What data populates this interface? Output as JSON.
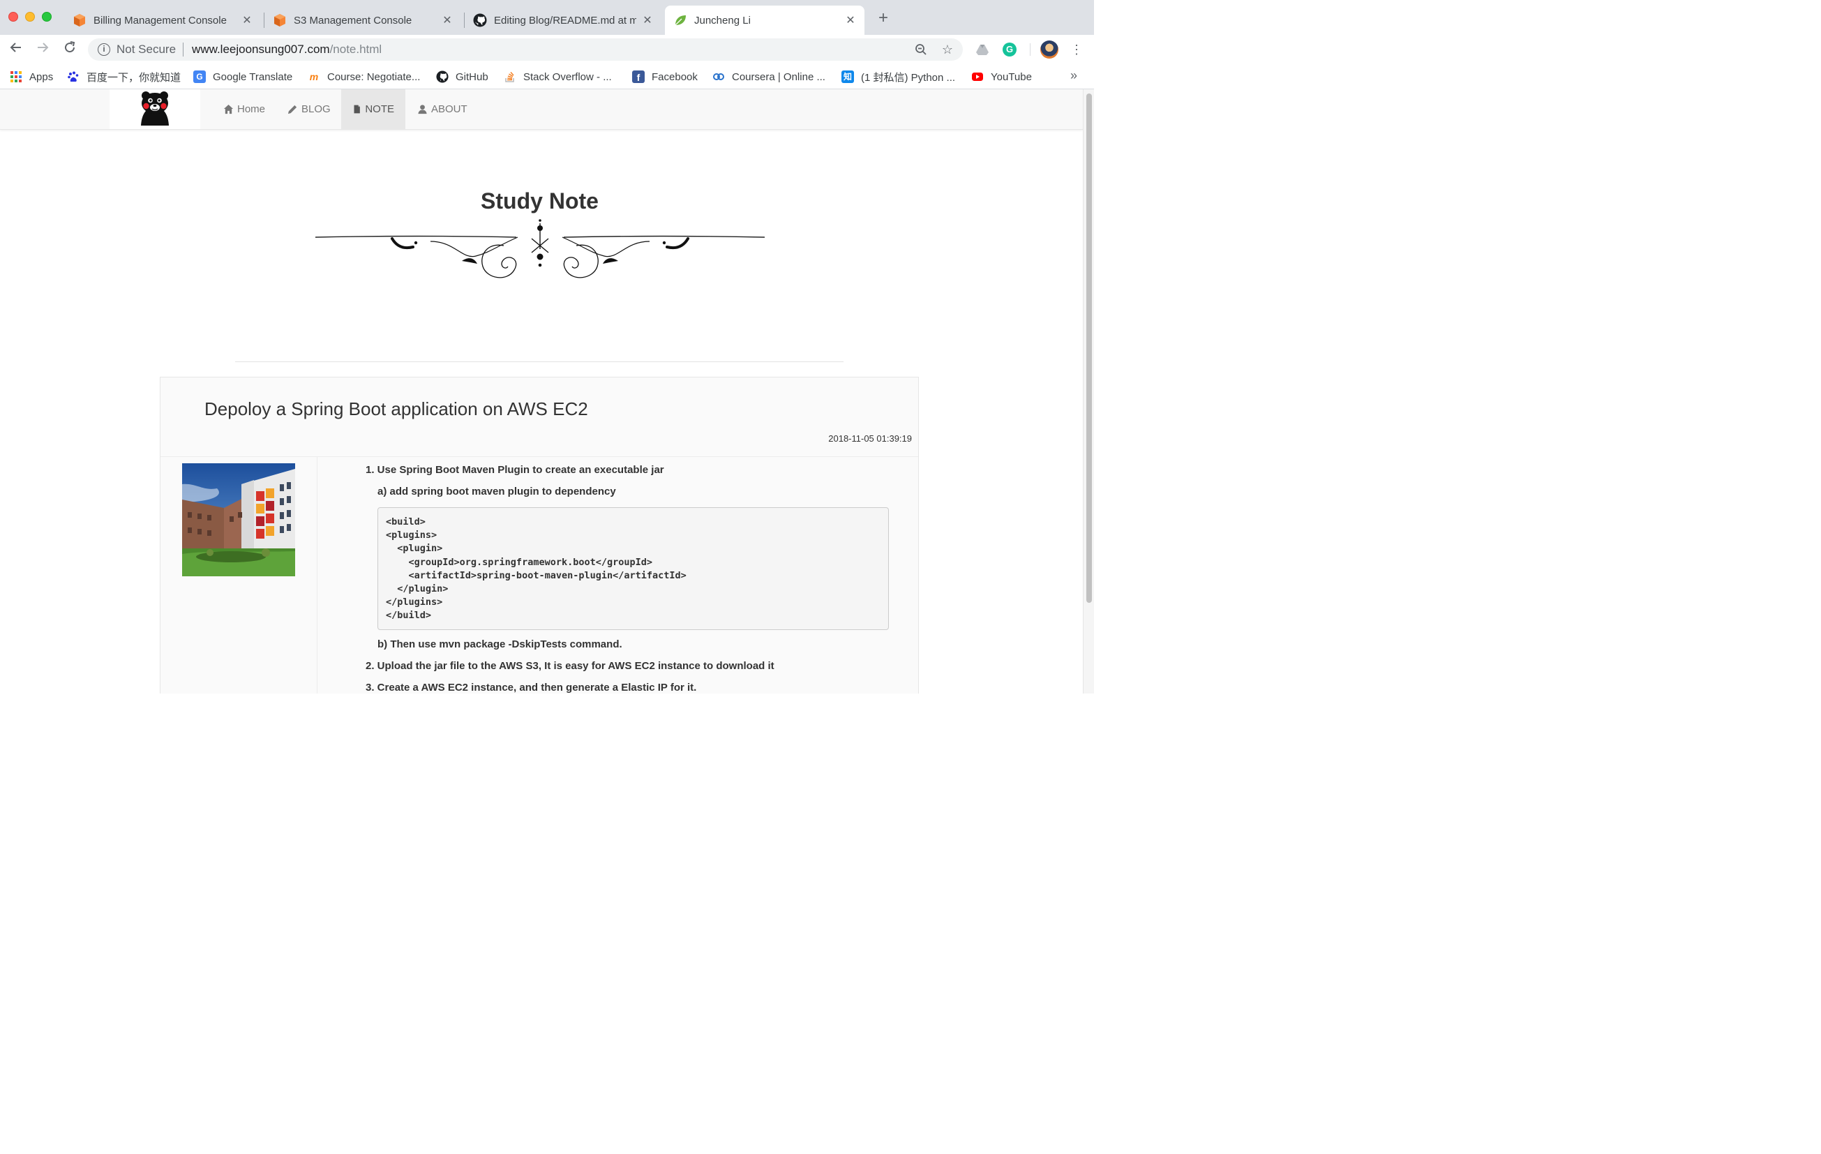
{
  "browser": {
    "tabs": [
      {
        "title": "Billing Management Console",
        "icon": "aws-cube-icon"
      },
      {
        "title": "S3 Management Console",
        "icon": "aws-cube-icon"
      },
      {
        "title": "Editing Blog/README.md at master",
        "icon": "github-icon"
      },
      {
        "title": "Juncheng Li",
        "icon": "leaf-icon",
        "active": true
      }
    ],
    "new_tab": "+",
    "address": {
      "security": "Not Secure",
      "host": "www.leejoonsung007.com",
      "path": "/note.html"
    },
    "bookmarks": [
      {
        "label": "Apps",
        "icon": "apps-grid-icon"
      },
      {
        "label": "百度一下，你就知道",
        "icon": "baidu-paw-icon"
      },
      {
        "label": "Google Translate",
        "icon": "google-translate-icon"
      },
      {
        "label": "Course: Negotiate...",
        "icon": "moodle-icon"
      },
      {
        "label": "GitHub",
        "icon": "github-icon"
      },
      {
        "label": "Stack Overflow - ...",
        "icon": "stackoverflow-icon"
      },
      {
        "label": "Facebook",
        "icon": "facebook-icon"
      },
      {
        "label": "Coursera | Online ...",
        "icon": "coursera-icon"
      },
      {
        "label": "(1 封私信) Python ...",
        "icon": "zhihu-icon"
      },
      {
        "label": "YouTube",
        "icon": "youtube-icon"
      }
    ],
    "bookmarks_more": "»"
  },
  "site": {
    "nav": [
      {
        "label": "Home",
        "icon": "home-icon"
      },
      {
        "label": "BLOG",
        "icon": "pencil-icon"
      },
      {
        "label": "NOTE",
        "icon": "file-icon",
        "active": true
      },
      {
        "label": "ABOUT",
        "icon": "user-icon"
      }
    ],
    "hero_title": "Study Note"
  },
  "post": {
    "title": "Depoloy a Spring Boot application on AWS EC2",
    "date": "2018-11-05 01:39:19",
    "steps": [
      "1. Use Spring Boot Maven Plugin to create an executable jar",
      "a) add spring boot maven plugin to dependency",
      "b) Then use mvn package -DskipTests command.",
      "2. Upload the jar file to the AWS S3, It is easy for AWS EC2 instance to download it",
      "3. Create a AWS EC2 instance, and then generate a Elastic IP for it."
    ],
    "code": "<build>\n<plugins>\n  <plugin>\n    <groupId>org.springframework.boot</groupId>\n    <artifactId>spring-boot-maven-plugin</artifactId>\n  </plugin>\n</plugins>\n</build>"
  },
  "colors": {
    "chrome_tabstrip": "#dee1e6",
    "navbar_bg": "#f8f8f8",
    "nav_active_bg": "#e7e7e7",
    "post_bg": "#fafafa"
  }
}
